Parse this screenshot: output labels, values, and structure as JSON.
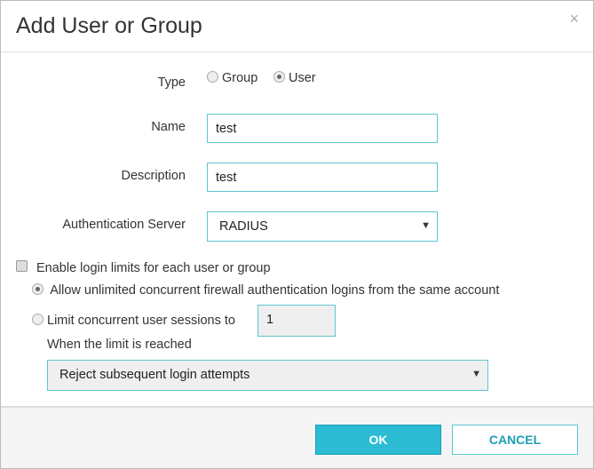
{
  "dialog": {
    "title": "Add User or Group",
    "close": "×"
  },
  "type": {
    "label": "Type",
    "options": [
      "Group",
      "User"
    ],
    "selected": "User"
  },
  "name": {
    "label": "Name",
    "value": "test"
  },
  "description": {
    "label": "Description",
    "value": "test"
  },
  "auth_server": {
    "label": "Authentication Server",
    "value": "RADIUS"
  },
  "limits": {
    "enable_label": "Enable login limits for each user or group",
    "enabled": false,
    "unlimited_label": "Allow unlimited concurrent firewall authentication logins from the same account",
    "limit_label": "Limit concurrent user sessions to",
    "limit_value": "1",
    "when_label": "When the limit is reached",
    "when_value": "Reject subsequent login attempts"
  },
  "buttons": {
    "ok": "OK",
    "cancel": "CANCEL"
  }
}
